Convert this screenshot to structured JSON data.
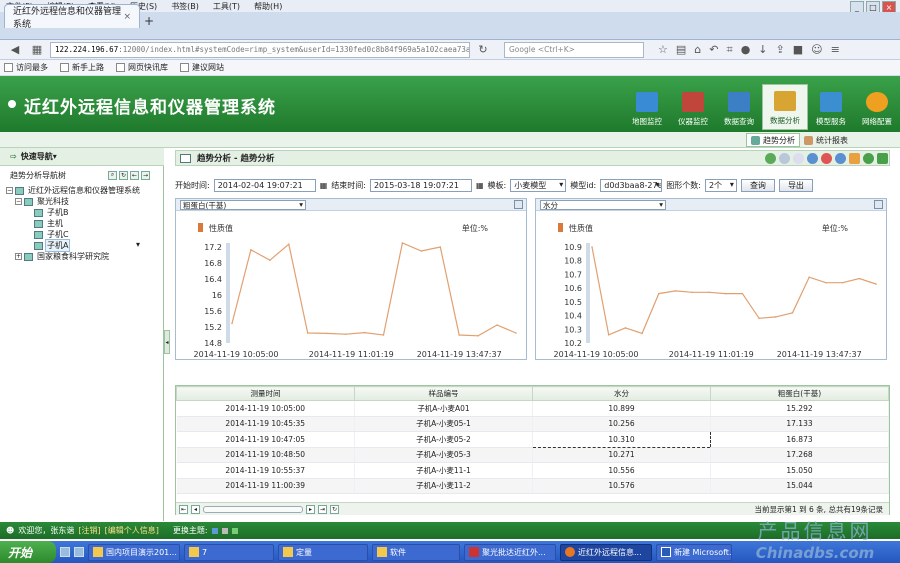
{
  "browser": {
    "menu": [
      "文件(F)",
      "编辑(E)",
      "查看(V)",
      "历史(S)",
      "书签(B)",
      "工具(T)",
      "帮助(H)"
    ],
    "tab_title": "近红外远程信息和仪器管理系统",
    "url_ip": "122.224.196.67",
    "url_rest": ":12000/index.html#systemCode=rimp_system&userId=1330fed0c8b84f969a5a102caea73a80",
    "search_placeholder": "Google <Ctrl+K>",
    "bookmarks": [
      "访问最多",
      "新手上路",
      "网页快讯库",
      "建议网站"
    ]
  },
  "app": {
    "title": "近红外远程信息和仪器管理系统",
    "modules": [
      {
        "label": "地图监控",
        "icon": "map-icon",
        "color": "#3a8bd6"
      },
      {
        "label": "仪器监控",
        "icon": "instrument-icon",
        "color": "#c0463c"
      },
      {
        "label": "数据查询",
        "icon": "data-query-icon",
        "color": "#3d7fc4"
      },
      {
        "label": "数据分析",
        "icon": "data-analysis-icon",
        "color": "#d8a533"
      },
      {
        "label": "模型服务",
        "icon": "model-service-icon",
        "color": "#3b8fd0"
      },
      {
        "label": "网络配置",
        "icon": "network-icon",
        "color": "#f0a020"
      }
    ],
    "subtabs": [
      "趋势分析",
      "统计报表"
    ]
  },
  "sidebar": {
    "title": "快速导航",
    "section": "趋势分析导航树",
    "tree": [
      {
        "label": "近红外远程信息和仪器管理系统",
        "level": 0,
        "sign": "-"
      },
      {
        "label": "聚光科技",
        "level": 1,
        "sign": "-"
      },
      {
        "label": "子机B",
        "level": 2
      },
      {
        "label": "主机",
        "level": 2
      },
      {
        "label": "子机C",
        "level": 2
      },
      {
        "label": "子机A",
        "level": 2,
        "selected": true
      },
      {
        "label": "国家粮食科学研究院",
        "level": 1,
        "sign": "+"
      }
    ]
  },
  "main": {
    "breadcrumb": "趋势分析 - 趋势分析",
    "filter": {
      "start_label": "开始时间:",
      "start_value": "2014-02-04 19:07:21",
      "end_label": "结束时间:",
      "end_value": "2015-03-18 19:07:21",
      "template_label": "模板:",
      "template_value": "小麦模型",
      "model_id_label": "模型id:",
      "model_id_value": "d0d3baa8-27e",
      "count_label": "图形个数:",
      "count_value": "2个",
      "query_button": "查询",
      "export_button": "导出"
    }
  },
  "chart_data": [
    {
      "type": "line",
      "title": "粗蛋白(干基)",
      "legend": "性质值",
      "unit_label": "单位:%",
      "ylim": [
        14.8,
        17.2
      ],
      "yticks": [
        "17.2",
        "16.8",
        "16.4",
        "16",
        "15.6",
        "15.2",
        "14.8"
      ],
      "xticks": [
        "2014-11-19 10:05:00",
        "2014-11-19 11:01:19",
        "2014-11-19 13:47:37"
      ],
      "values": [
        15.29,
        17.13,
        16.87,
        17.27,
        15.05,
        15.04,
        15.02,
        15.06,
        15.0,
        17.3,
        17.1,
        17.2,
        15.0,
        14.98,
        15.25,
        15.05
      ],
      "color": "#e0a070"
    },
    {
      "type": "line",
      "title": "水分",
      "legend": "性质值",
      "unit_label": "单位:%",
      "ylim": [
        10.2,
        10.9
      ],
      "yticks": [
        "10.9",
        "10.8",
        "10.7",
        "10.6",
        "10.5",
        "10.4",
        "10.3",
        "10.2"
      ],
      "xticks": [
        "2014-11-19 10:05:00",
        "2014-11-19 11:01:19",
        "2014-11-19 13:47:37"
      ],
      "values": [
        10.9,
        10.26,
        10.31,
        10.27,
        10.56,
        10.58,
        10.57,
        10.57,
        10.56,
        10.56,
        10.38,
        10.39,
        10.42,
        10.68,
        10.64,
        10.64,
        10.67,
        10.63
      ],
      "color": "#e0a070"
    }
  ],
  "table": {
    "headers": [
      "测量时间",
      "样品编号",
      "水分",
      "粗蛋白(干基)"
    ],
    "rows": [
      [
        "2014-11-19 10:05:00",
        "子机A-小麦A01",
        "10.899",
        "15.292"
      ],
      [
        "2014-11-19 10:45:35",
        "子机A-小麦05-1",
        "10.256",
        "17.133"
      ],
      [
        "2014-11-19 10:47:05",
        "子机A-小麦05-2",
        "10.310",
        "16.873"
      ],
      [
        "2014-11-19 10:48:50",
        "子机A-小麦05-3",
        "10.271",
        "17.268"
      ],
      [
        "2014-11-19 10:55:37",
        "子机A-小麦11-1",
        "10.556",
        "15.050"
      ],
      [
        "2014-11-19 11:00:39",
        "子机A-小麦11-2",
        "10.576",
        "15.044"
      ]
    ],
    "pager_info": "当前显示第1 到 6 条, 总共有19条记录"
  },
  "status": {
    "welcome": "欢迎您，张东谐",
    "logout": "[注销]",
    "edit": "[编辑个人信息]",
    "theme": "更换主题:"
  },
  "taskbar": {
    "start": "开始",
    "tasks": [
      "国内项目演示201...",
      "7",
      "定量",
      "软件",
      "聚光批达近红外...",
      "近红外远程信息...",
      "新建 Microsoft..."
    ]
  },
  "watermark": {
    "line1": "产品信息网",
    "line2": "Chinadbs.com"
  }
}
